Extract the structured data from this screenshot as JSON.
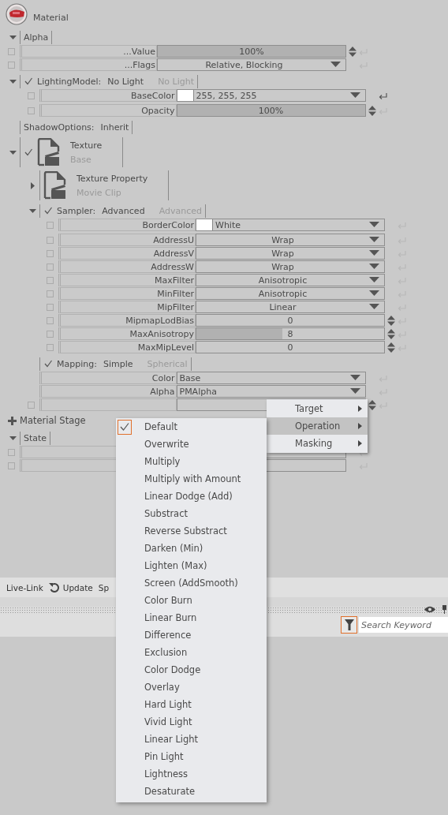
{
  "header": {
    "title": "Material"
  },
  "items": [
    {
      "kind": "category",
      "label": "Alpha",
      "expanded": true,
      "children": [
        {
          "kind": "spinner",
          "checked": false,
          "label": "...Value",
          "value": "100%",
          "level": 1
        },
        {
          "kind": "dropdown",
          "checked": false,
          "label": "...Flags",
          "value": "Relative, Blocking"
        }
      ]
    },
    {
      "kind": "group",
      "label": "LightingModel:",
      "value": "No Light",
      "hint": "No Light",
      "checked": true,
      "expanded": true,
      "children": [
        {
          "kind": "color",
          "checked": false,
          "label": "BaseColor",
          "value": "255, 255, 255"
        },
        {
          "kind": "spinner",
          "checked": false,
          "label": "Opacity",
          "value": "100%",
          "level": 1
        }
      ]
    },
    {
      "kind": "group",
      "label": "ShadowOptions:",
      "value": "Inherit"
    },
    {
      "kind": "asset",
      "title": "Texture",
      "subtitle": "Base",
      "checked": true,
      "expanded": true,
      "children": [
        {
          "kind": "asset",
          "title": "Texture Property",
          "subtitle": "Movie Clip",
          "expanded": false
        },
        {
          "kind": "group",
          "label": "Sampler:",
          "value": "Advanced",
          "hint": "Advanced",
          "checked": true,
          "expanded": true,
          "children": [
            {
              "kind": "color",
              "checked": false,
              "label": "BorderColor",
              "value": "White"
            },
            {
              "kind": "dropdown",
              "checked": false,
              "label": "AddressU",
              "value": "Wrap"
            },
            {
              "kind": "dropdown",
              "checked": false,
              "label": "AddressV",
              "value": "Wrap"
            },
            {
              "kind": "dropdown",
              "checked": false,
              "label": "AddressW",
              "value": "Wrap"
            },
            {
              "kind": "dropdown",
              "checked": false,
              "label": "MaxFilter",
              "value": "Anisotropic"
            },
            {
              "kind": "dropdown",
              "checked": false,
              "label": "MinFilter",
              "value": "Anisotropic"
            },
            {
              "kind": "dropdown",
              "checked": false,
              "label": "MipFilter",
              "value": "Linear"
            },
            {
              "kind": "spinner",
              "checked": false,
              "label": "MipmapLodBias",
              "value": "0"
            },
            {
              "kind": "spinner",
              "checked": false,
              "label": "MaxAnisotropy",
              "value": "8",
              "level": 0.46
            },
            {
              "kind": "spinner",
              "checked": false,
              "label": "MaxMipLevel",
              "value": "0"
            }
          ]
        },
        {
          "kind": "category",
          "label": "Mapping:",
          "value": "Simple",
          "hint": "Spherical",
          "checked": true,
          "children": [
            {
              "kind": "select",
              "label": "Color",
              "value": "Base"
            },
            {
              "kind": "select",
              "label": "Alpha",
              "value": "PMAlpha"
            },
            {
              "kind": "spinner",
              "checked": false
            }
          ]
        }
      ]
    },
    {
      "kind": "add",
      "label": "Material Stage"
    },
    {
      "kind": "category",
      "label": "State",
      "expanded": true,
      "children": [
        {
          "kind": "blank",
          "checked": false
        },
        {
          "kind": "blank",
          "checked": false
        }
      ]
    }
  ],
  "toolbar": {
    "live_link": "Live-Link",
    "update": "Update",
    "cut_item": "Sp"
  },
  "search": {
    "placeholder": "Search Keyword"
  },
  "submenu": [
    {
      "label": "Target",
      "selected": false
    },
    {
      "label": "Operation",
      "selected": true
    },
    {
      "label": "Masking",
      "selected": false
    }
  ],
  "menu": [
    {
      "label": "Default",
      "checked": true
    },
    {
      "label": "Overwrite",
      "checked": false
    },
    {
      "label": "Multiply",
      "checked": false
    },
    {
      "label": "Multiply with Amount",
      "checked": false
    },
    {
      "label": "Linear Dodge (Add)",
      "checked": false
    },
    {
      "label": "Substract",
      "checked": false
    },
    {
      "label": "Reverse Substract",
      "checked": false
    },
    {
      "label": "Darken (Min)",
      "checked": false
    },
    {
      "label": "Lighten (Max)",
      "checked": false
    },
    {
      "label": "Screen (AddSmooth)",
      "checked": false
    },
    {
      "label": "Color Burn",
      "checked": false
    },
    {
      "label": "Linear Burn",
      "checked": false
    },
    {
      "label": "Difference",
      "checked": false
    },
    {
      "label": "Exclusion",
      "checked": false
    },
    {
      "label": "Color Dodge",
      "checked": false
    },
    {
      "label": "Overlay",
      "checked": false
    },
    {
      "label": "Hard Light",
      "checked": false
    },
    {
      "label": "Vivid Light",
      "checked": false
    },
    {
      "label": "Linear Light",
      "checked": false
    },
    {
      "label": "Pin Light",
      "checked": false
    },
    {
      "label": "Lightness",
      "checked": false
    },
    {
      "label": "Desaturate",
      "checked": false
    }
  ]
}
